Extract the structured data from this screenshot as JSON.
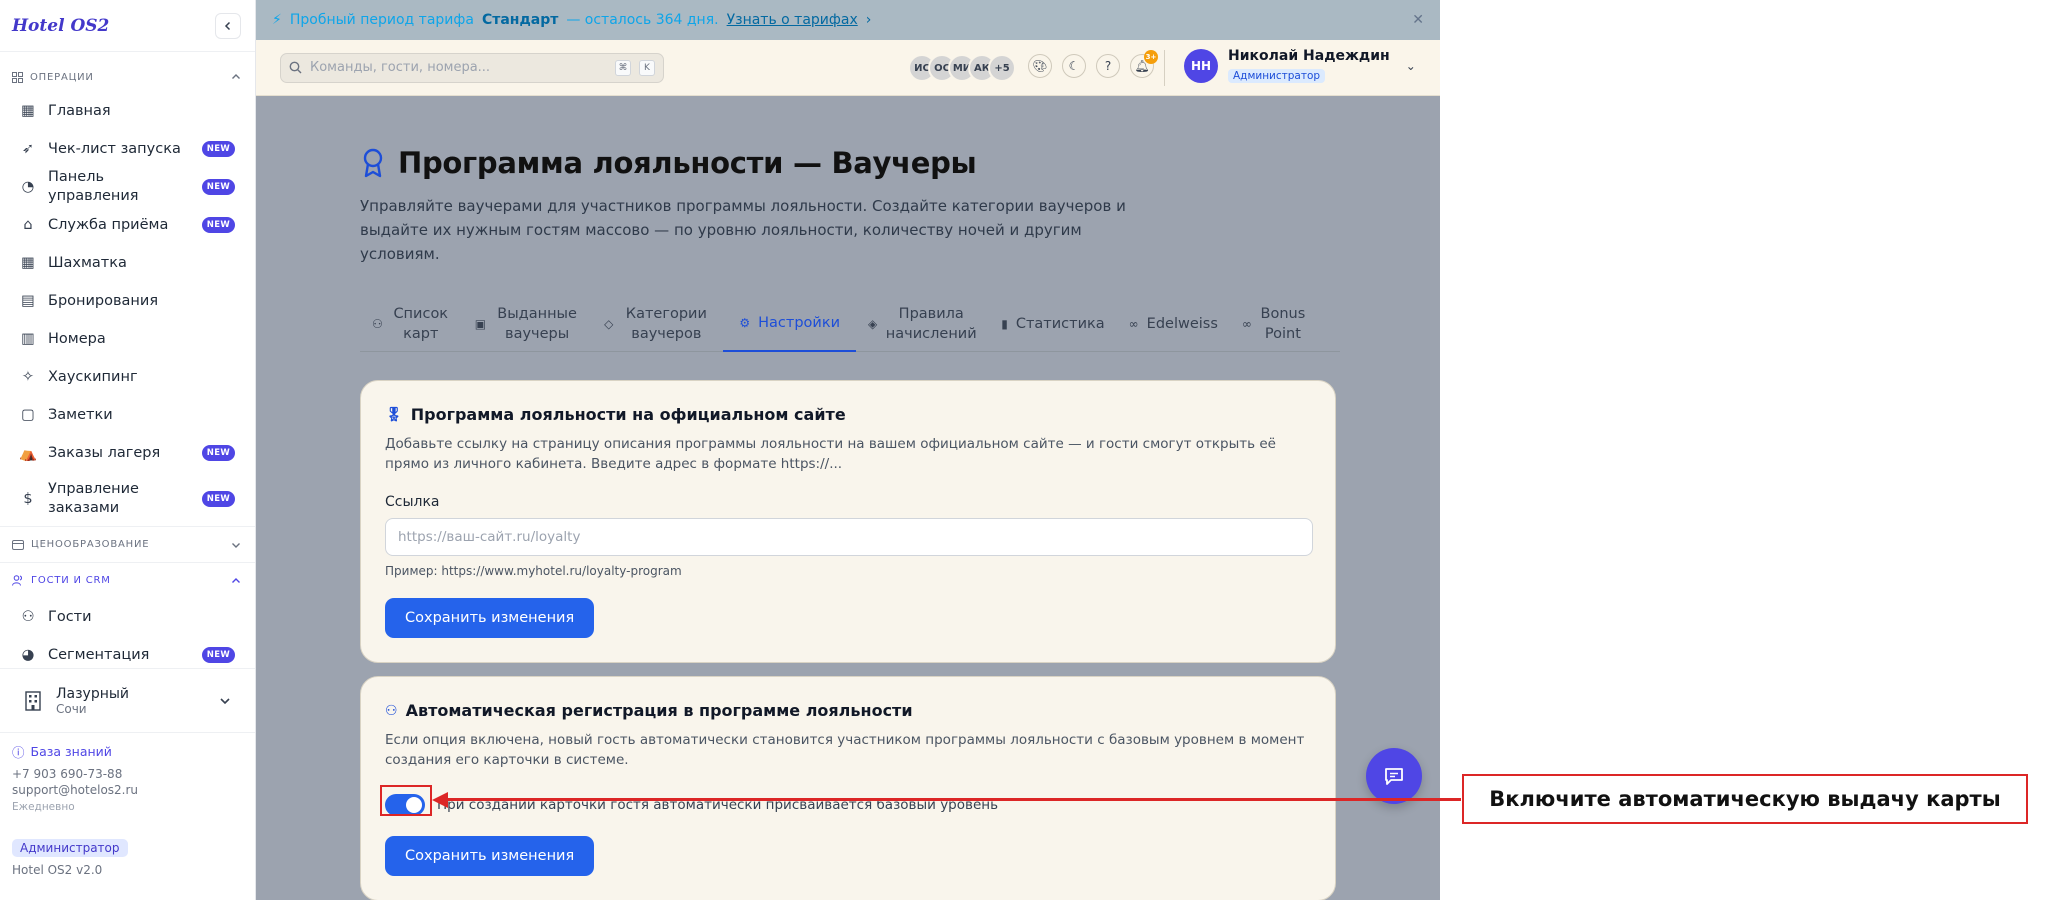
{
  "sidebar": {
    "logo": "Hotel OS2",
    "sections": {
      "operations": "ОПЕРАЦИИ",
      "pricing": "ЦЕНООБРАЗОВАНИЕ",
      "guests": "ГОСТИ И CRM"
    },
    "items": [
      {
        "label": "Главная",
        "icon": "home-grid-icon",
        "badge": ""
      },
      {
        "label": "Чек-лист запуска",
        "icon": "rocket-icon",
        "badge": "NEW"
      },
      {
        "label": "Панель управления",
        "icon": "gauge-icon",
        "badge": "NEW"
      },
      {
        "label": "Служба приёма",
        "icon": "bell-desk-icon",
        "badge": "NEW"
      },
      {
        "label": "Шахматка",
        "icon": "grid-icon",
        "badge": ""
      },
      {
        "label": "Бронирования",
        "icon": "clipboard-icon",
        "badge": ""
      },
      {
        "label": "Номера",
        "icon": "building-icon",
        "badge": ""
      },
      {
        "label": "Хаускипинг",
        "icon": "sparkle-icon",
        "badge": ""
      },
      {
        "label": "Заметки",
        "icon": "note-icon",
        "badge": ""
      },
      {
        "label": "Заказы лагеря",
        "icon": "tent-icon",
        "badge": "NEW"
      },
      {
        "label": "Управление заказами",
        "icon": "dollar-doc-icon",
        "badge": "NEW"
      }
    ],
    "guest_items": [
      {
        "label": "Гости",
        "icon": "users-icon",
        "badge": ""
      },
      {
        "label": "Сегментация",
        "icon": "pie-icon",
        "badge": "NEW"
      }
    ],
    "hotel": {
      "name": "Лазурный",
      "city": "Сочи"
    },
    "footer": {
      "knowledge_base": "База знаний",
      "phone": "+7 903 690-73-88",
      "email": "support@hotelos2.ru",
      "schedule": "Ежедневно",
      "role": "Администратор",
      "version": "Hotel OS2 v2.0"
    }
  },
  "trial": {
    "prefix": "Пробный период тарифа",
    "plan": "Стандарт",
    "suffix": "— осталось 364 дня.",
    "link": "Узнать о тарифах"
  },
  "topbar": {
    "search_placeholder": "Команды, гости, номера...",
    "kbd1": "⌘",
    "kbd2": "K",
    "avatars": [
      "ИС",
      "ОС",
      "МИ",
      "АК",
      "+5"
    ],
    "notif_count": "3+",
    "user_initials": "НН",
    "user_name": "Николай Надеждин",
    "user_role": "Администратор"
  },
  "page": {
    "title": "Программа лояльности — Ваучеры",
    "subtitle": "Управляйте ваучерами для участников программы лояльности. Создайте категории ваучеров и выдайте их нужным гостям массово — по уровню лояльности, количеству ночей и другим условиям.",
    "tabs": [
      {
        "label": "Список карт",
        "icon": "users-icon"
      },
      {
        "label": "Выданные ваучеры",
        "icon": "ticket-icon"
      },
      {
        "label": "Категории ваучеров",
        "icon": "tag-icon"
      },
      {
        "label": "Настройки",
        "icon": "gear-icon"
      },
      {
        "label": "Правила начислений",
        "icon": "layers-icon"
      },
      {
        "label": "Статистика",
        "icon": "bar-chart-icon"
      },
      {
        "label": "Edelweiss",
        "icon": "link-icon"
      },
      {
        "label": "Bonus Point",
        "icon": "link-icon"
      }
    ],
    "active_tab": "Настройки"
  },
  "card_site": {
    "title": "Программа лояльности на официальном сайте",
    "desc": "Добавьте ссылку на страницу описания программы лояльности на вашем официальном сайте — и гости смогут открыть её прямо из личного кабинета. Введите адрес в формате https://...",
    "field_label": "Ссылка",
    "placeholder": "https://ваш-сайт.ru/loyalty",
    "hint": "Пример: https://www.myhotel.ru/loyalty-program",
    "save": "Сохранить изменения"
  },
  "card_auto": {
    "title": "Автоматическая регистрация в программе лояльности",
    "desc": "Если опция включена, новый гость автоматически становится участником программы лояльности с базовым уровнем в момент создания его карточки в системе.",
    "toggle_label": "При создании карточки гостя автоматически присваивается базовый уровень",
    "toggle_on": true,
    "save": "Сохранить изменения"
  },
  "annotation": {
    "callout": "Включите автоматическую выдачу карты",
    "color": "#dc2626"
  }
}
